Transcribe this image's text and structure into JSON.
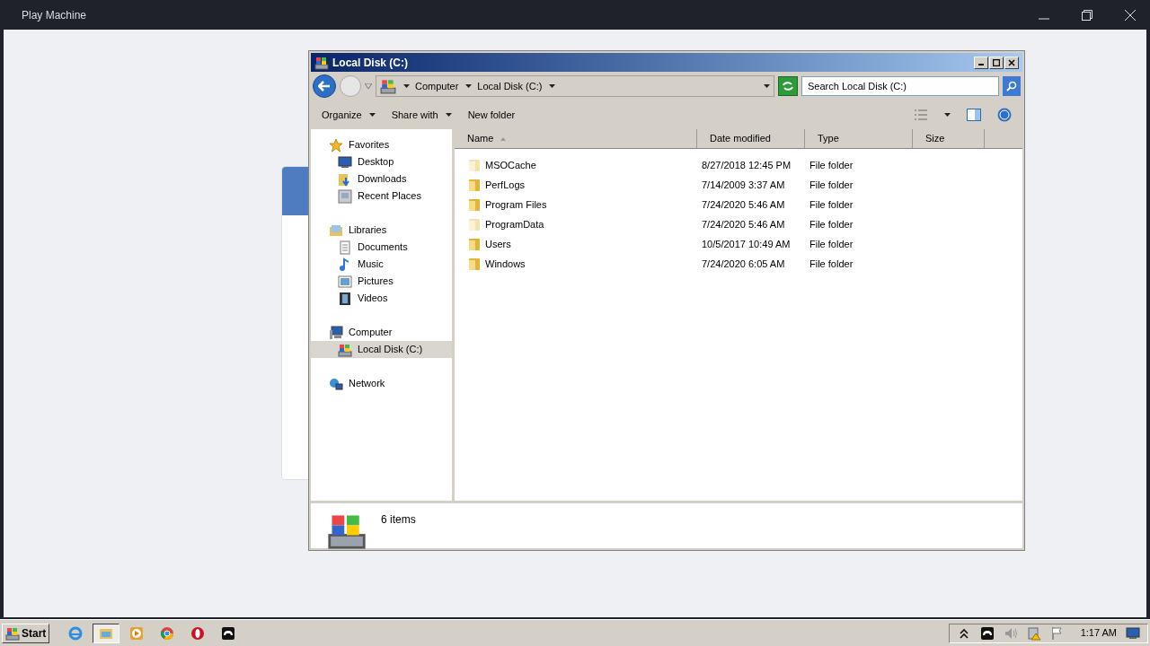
{
  "host": {
    "title": "Play Machine"
  },
  "explorer": {
    "title": "Local Disk (C:)",
    "breadcrumb": [
      "Computer",
      "Local Disk (C:)"
    ],
    "search": {
      "placeholder": "Search Local Disk (C:)"
    },
    "toolbar": [
      {
        "label": "Organize",
        "dropdown": true
      },
      {
        "label": "Share with",
        "dropdown": true
      },
      {
        "label": "New folder",
        "dropdown": false
      }
    ],
    "nav": [
      {
        "label": "Favorites",
        "kind": "star",
        "selected": false,
        "children": [
          {
            "label": "Desktop",
            "kind": "desktop",
            "selected": false
          },
          {
            "label": "Downloads",
            "kind": "downloads",
            "selected": false
          },
          {
            "label": "Recent Places",
            "kind": "recent",
            "selected": false
          }
        ]
      },
      {
        "label": "Libraries",
        "kind": "library",
        "selected": false,
        "children": [
          {
            "label": "Documents",
            "kind": "documents",
            "selected": false
          },
          {
            "label": "Music",
            "kind": "music",
            "selected": false
          },
          {
            "label": "Pictures",
            "kind": "pictures",
            "selected": false
          },
          {
            "label": "Videos",
            "kind": "videos",
            "selected": false
          }
        ]
      },
      {
        "label": "Computer",
        "kind": "computer",
        "selected": false,
        "children": [
          {
            "label": "Local Disk (C:)",
            "kind": "disk",
            "selected": true
          }
        ]
      },
      {
        "label": "Network",
        "kind": "network",
        "selected": false
      }
    ],
    "columns": [
      {
        "label": "Name",
        "sorted": true
      },
      {
        "label": "Date modified",
        "sorted": false
      },
      {
        "label": "Type",
        "sorted": false
      },
      {
        "label": "Size",
        "sorted": false
      }
    ],
    "rows": [
      {
        "name": "MSOCache",
        "date": "8/27/2018 12:45 PM",
        "type": "File folder",
        "hidden": true
      },
      {
        "name": "PerfLogs",
        "date": "7/14/2009 3:37 AM",
        "type": "File folder",
        "hidden": false
      },
      {
        "name": "Program Files",
        "date": "7/24/2020 5:46 AM",
        "type": "File folder",
        "hidden": false
      },
      {
        "name": "ProgramData",
        "date": "7/24/2020 5:46 AM",
        "type": "File folder",
        "hidden": true
      },
      {
        "name": "Users",
        "date": "10/5/2017 10:49 AM",
        "type": "File folder",
        "hidden": false
      },
      {
        "name": "Windows",
        "date": "7/24/2020 6:05 AM",
        "type": "File folder",
        "hidden": false
      }
    ],
    "status": "6 items"
  },
  "taskbar": {
    "start": "Start",
    "apps": [
      {
        "kind": "ie",
        "selected": false
      },
      {
        "kind": "explorer",
        "selected": true
      },
      {
        "kind": "player",
        "selected": false
      },
      {
        "kind": "chrome",
        "selected": false
      },
      {
        "kind": "opera",
        "selected": false
      },
      {
        "kind": "gamepad",
        "selected": false
      }
    ],
    "tray": [
      {
        "kind": "chevron"
      },
      {
        "kind": "gamepad"
      },
      {
        "kind": "speaker"
      },
      {
        "kind": "network-warning"
      },
      {
        "kind": "flag"
      }
    ],
    "clock": "1:17 AM"
  }
}
